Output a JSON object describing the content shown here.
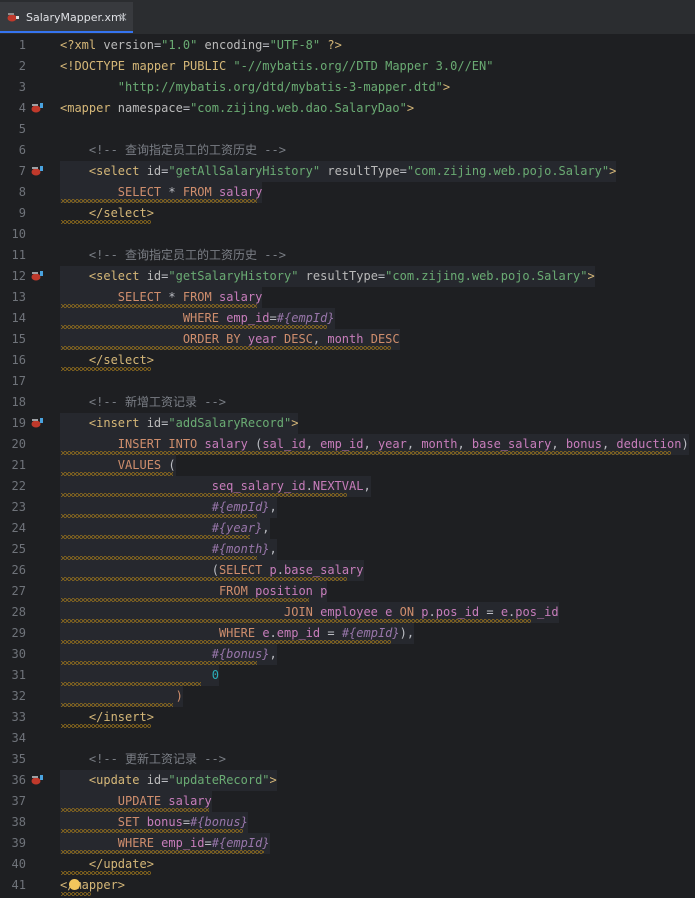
{
  "tab": {
    "title": "SalaryMapper.xml",
    "close": "×",
    "icon": "mybatis-xml-icon"
  },
  "colors": {
    "tag": "#d5b778",
    "attr": "#bababa",
    "value": "#6aab73",
    "comment": "#7a7e85",
    "keyword": "#cf8e6d",
    "identifier": "#c77dbb",
    "param": "#9876aa",
    "number": "#2aacb8"
  },
  "lines": [
    {
      "n": "1",
      "segs": [
        [
          "t-pi",
          "<?xml "
        ],
        [
          "t-attr",
          "version"
        ],
        [
          "t-txt",
          "="
        ],
        [
          "t-val",
          "\"1.0\""
        ],
        [
          "t-txt",
          " "
        ],
        [
          "t-attr",
          "encoding"
        ],
        [
          "t-txt",
          "="
        ],
        [
          "t-val",
          "\"UTF-8\""
        ],
        [
          "t-pi",
          " ?>"
        ]
      ]
    },
    {
      "n": "2",
      "segs": [
        [
          "t-tag",
          "<!DOCTYPE mapper PUBLIC "
        ],
        [
          "t-val",
          "\"-//mybatis.org//DTD Mapper 3.0//EN\""
        ]
      ]
    },
    {
      "n": "3",
      "segs": [
        [
          "t-txt",
          "        "
        ],
        [
          "t-val",
          "\"http://mybatis.org/dtd/mybatis-3-mapper.dtd\""
        ],
        [
          "t-tag",
          ">"
        ]
      ]
    },
    {
      "n": "4",
      "icon": true,
      "segs": [
        [
          "t-tag",
          "<mapper "
        ],
        [
          "t-attr",
          "namespace"
        ],
        [
          "t-txt",
          "="
        ],
        [
          "t-val",
          "\"com.zijing.web.dao.SalaryDao\""
        ],
        [
          "t-tag",
          ">"
        ]
      ]
    },
    {
      "n": "5",
      "segs": []
    },
    {
      "n": "6",
      "segs": [
        [
          "t-com",
          "    <!-- 查询指定员工的工资历史 -->"
        ]
      ]
    },
    {
      "n": "7",
      "icon": true,
      "hl": true,
      "segs": [
        [
          "t-txt",
          "    "
        ],
        [
          "t-tag",
          "<select "
        ],
        [
          "t-attr",
          "id"
        ],
        [
          "t-txt",
          "="
        ],
        [
          "t-val",
          "\"getAllSalaryHistory\""
        ],
        [
          "t-txt",
          " "
        ],
        [
          "t-attr",
          "resultType"
        ],
        [
          "t-txt",
          "="
        ],
        [
          "t-val",
          "\"com.zijing.web.pojo.Salary\""
        ],
        [
          "t-tag",
          ">"
        ]
      ]
    },
    {
      "n": "8",
      "hl": true,
      "wavy": [
        61,
        196
      ],
      "segs": [
        [
          "t-txt",
          "        "
        ],
        [
          "t-kw",
          "SELECT"
        ],
        [
          "t-txt",
          " * "
        ],
        [
          "t-kw",
          "FROM"
        ],
        [
          "t-txt",
          " "
        ],
        [
          "t-tbl",
          "salary"
        ]
      ]
    },
    {
      "n": "9",
      "wavy": [
        61,
        90
      ],
      "segs": [
        [
          "t-txt",
          "    "
        ],
        [
          "t-tag",
          "</select>"
        ]
      ]
    },
    {
      "n": "10",
      "segs": []
    },
    {
      "n": "11",
      "segs": [
        [
          "t-com",
          "    <!-- 查询指定员工的工资历史 -->"
        ]
      ]
    },
    {
      "n": "12",
      "icon": true,
      "hl": true,
      "segs": [
        [
          "t-txt",
          "    "
        ],
        [
          "t-tag",
          "<select "
        ],
        [
          "t-attr",
          "id"
        ],
        [
          "t-txt",
          "="
        ],
        [
          "t-val",
          "\"getSalaryHistory\""
        ],
        [
          "t-txt",
          " "
        ],
        [
          "t-attr",
          "resultType"
        ],
        [
          "t-txt",
          "="
        ],
        [
          "t-val",
          "\"com.zijing.web.pojo.Salary\""
        ],
        [
          "t-tag",
          ">"
        ]
      ]
    },
    {
      "n": "13",
      "hl": true,
      "wavy": [
        61,
        196
      ],
      "segs": [
        [
          "t-txt",
          "        "
        ],
        [
          "t-kw",
          "SELECT"
        ],
        [
          "t-txt",
          " * "
        ],
        [
          "t-kw",
          "FROM"
        ],
        [
          "t-txt",
          " "
        ],
        [
          "t-tbl",
          "salary"
        ]
      ]
    },
    {
      "n": "14",
      "hl": true,
      "wavy": [
        61,
        266
      ],
      "segs": [
        [
          "t-txt",
          "                 "
        ],
        [
          "t-kw",
          "WHERE"
        ],
        [
          "t-txt",
          " "
        ],
        [
          "t-col",
          "emp_id"
        ],
        [
          "t-txt",
          "="
        ],
        [
          "t-var",
          "#{empId}"
        ]
      ]
    },
    {
      "n": "15",
      "hl": true,
      "wavy": [
        61,
        330
      ],
      "segs": [
        [
          "t-txt",
          "                 "
        ],
        [
          "t-kw",
          "ORDER BY"
        ],
        [
          "t-txt",
          " "
        ],
        [
          "t-col",
          "year"
        ],
        [
          "t-txt",
          " "
        ],
        [
          "t-kw",
          "DESC"
        ],
        [
          "t-txt",
          ", "
        ],
        [
          "t-col",
          "month"
        ],
        [
          "t-txt",
          " "
        ],
        [
          "t-kw",
          "DESC"
        ]
      ]
    },
    {
      "n": "16",
      "wavy": [
        61,
        90
      ],
      "segs": [
        [
          "t-txt",
          "    "
        ],
        [
          "t-tag",
          "</select>"
        ]
      ]
    },
    {
      "n": "17",
      "segs": []
    },
    {
      "n": "18",
      "segs": [
        [
          "t-com",
          "    <!-- 新增工资记录 -->"
        ]
      ]
    },
    {
      "n": "19",
      "icon": true,
      "hl": true,
      "segs": [
        [
          "t-txt",
          "    "
        ],
        [
          "t-tag",
          "<insert "
        ],
        [
          "t-attr",
          "id"
        ],
        [
          "t-txt",
          "="
        ],
        [
          "t-val",
          "\"addSalaryRecord\""
        ],
        [
          "t-tag",
          ">"
        ]
      ]
    },
    {
      "n": "20",
      "hl": true,
      "wavy": [
        61,
        610
      ],
      "segs": [
        [
          "t-txt",
          "        "
        ],
        [
          "t-kw",
          "INSERT INTO"
        ],
        [
          "t-txt",
          " "
        ],
        [
          "t-tbl",
          "salary"
        ],
        [
          "t-txt",
          " ("
        ],
        [
          "t-col",
          "sal_id"
        ],
        [
          "t-txt",
          ", "
        ],
        [
          "t-col",
          "emp_id"
        ],
        [
          "t-txt",
          ", "
        ],
        [
          "t-col",
          "year"
        ],
        [
          "t-txt",
          ", "
        ],
        [
          "t-col",
          "month"
        ],
        [
          "t-txt",
          ", "
        ],
        [
          "t-col",
          "base_salary"
        ],
        [
          "t-txt",
          ", "
        ],
        [
          "t-col",
          "bonus"
        ],
        [
          "t-txt",
          ", "
        ],
        [
          "t-col",
          "deduction"
        ],
        [
          "t-txt",
          ")"
        ]
      ]
    },
    {
      "n": "21",
      "hl": true,
      "wavy": [
        61,
        112
      ],
      "segs": [
        [
          "t-txt",
          "        "
        ],
        [
          "t-kw",
          "VALUES"
        ],
        [
          "t-txt",
          " ("
        ]
      ]
    },
    {
      "n": "22",
      "hl": true,
      "wavy": [
        61,
        286
      ],
      "segs": [
        [
          "t-txt",
          "                     "
        ],
        [
          "t-tbl",
          "seq_salary_id"
        ],
        [
          "t-txt",
          "."
        ],
        [
          "t-col",
          "NEXTVAL"
        ],
        [
          "t-txt",
          ","
        ]
      ]
    },
    {
      "n": "23",
      "hl": true,
      "wavy": [
        61,
        196
      ],
      "segs": [
        [
          "t-txt",
          "                     "
        ],
        [
          "t-var",
          "#{empId}"
        ],
        [
          "t-txt",
          ","
        ]
      ]
    },
    {
      "n": "24",
      "hl": true,
      "wavy": [
        61,
        189
      ],
      "segs": [
        [
          "t-txt",
          "                     "
        ],
        [
          "t-var",
          "#{year}"
        ],
        [
          "t-txt",
          ","
        ]
      ]
    },
    {
      "n": "25",
      "hl": true,
      "wavy": [
        61,
        196
      ],
      "segs": [
        [
          "t-txt",
          "                     "
        ],
        [
          "t-var",
          "#{month}"
        ],
        [
          "t-txt",
          ","
        ]
      ]
    },
    {
      "n": "26",
      "hl": true,
      "wavy": [
        61,
        286
      ],
      "segs": [
        [
          "t-txt",
          "                     ("
        ],
        [
          "t-kw",
          "SELECT"
        ],
        [
          "t-txt",
          " "
        ],
        [
          "t-tbl",
          "p"
        ],
        [
          "t-txt",
          "."
        ],
        [
          "t-col",
          "base_salary"
        ]
      ]
    },
    {
      "n": "27",
      "hl": true,
      "wavy": [
        61,
        248
      ],
      "segs": [
        [
          "t-txt",
          "                      "
        ],
        [
          "t-kw",
          "FROM"
        ],
        [
          "t-txt",
          " "
        ],
        [
          "t-tbl",
          "position"
        ],
        [
          "t-txt",
          " "
        ],
        [
          "t-tbl",
          "p"
        ]
      ]
    },
    {
      "n": "28",
      "hl": true,
      "wavy": [
        61,
        470
      ],
      "segs": [
        [
          "t-txt",
          "                               "
        ],
        [
          "t-kw",
          "JOIN"
        ],
        [
          "t-txt",
          " "
        ],
        [
          "t-tbl",
          "employee"
        ],
        [
          "t-txt",
          " "
        ],
        [
          "t-tbl",
          "e"
        ],
        [
          "t-txt",
          " "
        ],
        [
          "t-kw",
          "ON"
        ],
        [
          "t-txt",
          " "
        ],
        [
          "t-tbl",
          "p"
        ],
        [
          "t-txt",
          "."
        ],
        [
          "t-col",
          "pos_id"
        ],
        [
          "t-txt",
          " = "
        ],
        [
          "t-tbl",
          "e"
        ],
        [
          "t-txt",
          "."
        ],
        [
          "t-col",
          "pos_id"
        ]
      ]
    },
    {
      "n": "29",
      "hl": true,
      "wavy": [
        61,
        330
      ],
      "segs": [
        [
          "t-txt",
          "                      "
        ],
        [
          "t-kw",
          "WHERE"
        ],
        [
          "t-txt",
          " "
        ],
        [
          "t-tbl",
          "e"
        ],
        [
          "t-txt",
          "."
        ],
        [
          "t-col",
          "emp_id"
        ],
        [
          "t-txt",
          " = "
        ],
        [
          "t-var",
          "#{empId}"
        ],
        [
          "t-txt",
          "),"
        ]
      ]
    },
    {
      "n": "30",
      "hl": true,
      "wavy": [
        61,
        196
      ],
      "segs": [
        [
          "t-txt",
          "                     "
        ],
        [
          "t-var",
          "#{bonus}"
        ],
        [
          "t-txt",
          ","
        ]
      ]
    },
    {
      "n": "31",
      "hl": true,
      "wavy": [
        61,
        140
      ],
      "segs": [
        [
          "t-txt",
          "                     "
        ],
        [
          "t-num",
          "0"
        ]
      ]
    },
    {
      "n": "32",
      "hl": true,
      "wavy": [
        61,
        112
      ],
      "segs": [
        [
          "t-txt",
          "                "
        ],
        [
          "t-kw",
          ")"
        ]
      ]
    },
    {
      "n": "33",
      "wavy": [
        61,
        90
      ],
      "segs": [
        [
          "t-txt",
          "    "
        ],
        [
          "t-tag",
          "</insert>"
        ]
      ]
    },
    {
      "n": "34",
      "segs": []
    },
    {
      "n": "35",
      "segs": [
        [
          "t-com",
          "    <!-- 更新工资记录 -->"
        ]
      ]
    },
    {
      "n": "36",
      "icon": true,
      "hl": true,
      "segs": [
        [
          "t-txt",
          "    "
        ],
        [
          "t-tag",
          "<update "
        ],
        [
          "t-attr",
          "id"
        ],
        [
          "t-txt",
          "="
        ],
        [
          "t-val",
          "\"updateRecord\""
        ],
        [
          "t-tag",
          ">"
        ]
      ]
    },
    {
      "n": "37",
      "hl": true,
      "wavy": [
        61,
        148
      ],
      "segs": [
        [
          "t-txt",
          "        "
        ],
        [
          "t-kw",
          "UPDATE"
        ],
        [
          "t-txt",
          " "
        ],
        [
          "t-tbl",
          "salary"
        ]
      ]
    },
    {
      "n": "38",
      "hl": true,
      "wavy": [
        61,
        182
      ],
      "segs": [
        [
          "t-txt",
          "        "
        ],
        [
          "t-kw",
          "SET"
        ],
        [
          "t-txt",
          " "
        ],
        [
          "t-col",
          "bonus"
        ],
        [
          "t-txt",
          "="
        ],
        [
          "t-var",
          "#{bonus}"
        ]
      ]
    },
    {
      "n": "39",
      "hl": true,
      "wavy": [
        61,
        203
      ],
      "segs": [
        [
          "t-txt",
          "        "
        ],
        [
          "t-kw",
          "WHERE"
        ],
        [
          "t-txt",
          " "
        ],
        [
          "t-col",
          "emp_id"
        ],
        [
          "t-txt",
          "="
        ],
        [
          "t-var",
          "#{empId}"
        ]
      ]
    },
    {
      "n": "40",
      "wavy": [
        61,
        90
      ],
      "segs": [
        [
          "t-txt",
          "    "
        ],
        [
          "t-tag",
          "</update>"
        ]
      ]
    },
    {
      "n": "41",
      "bulb": true,
      "wavy": [
        61,
        30
      ],
      "segs": [
        [
          "t-tag",
          "</mapper>"
        ]
      ]
    }
  ]
}
